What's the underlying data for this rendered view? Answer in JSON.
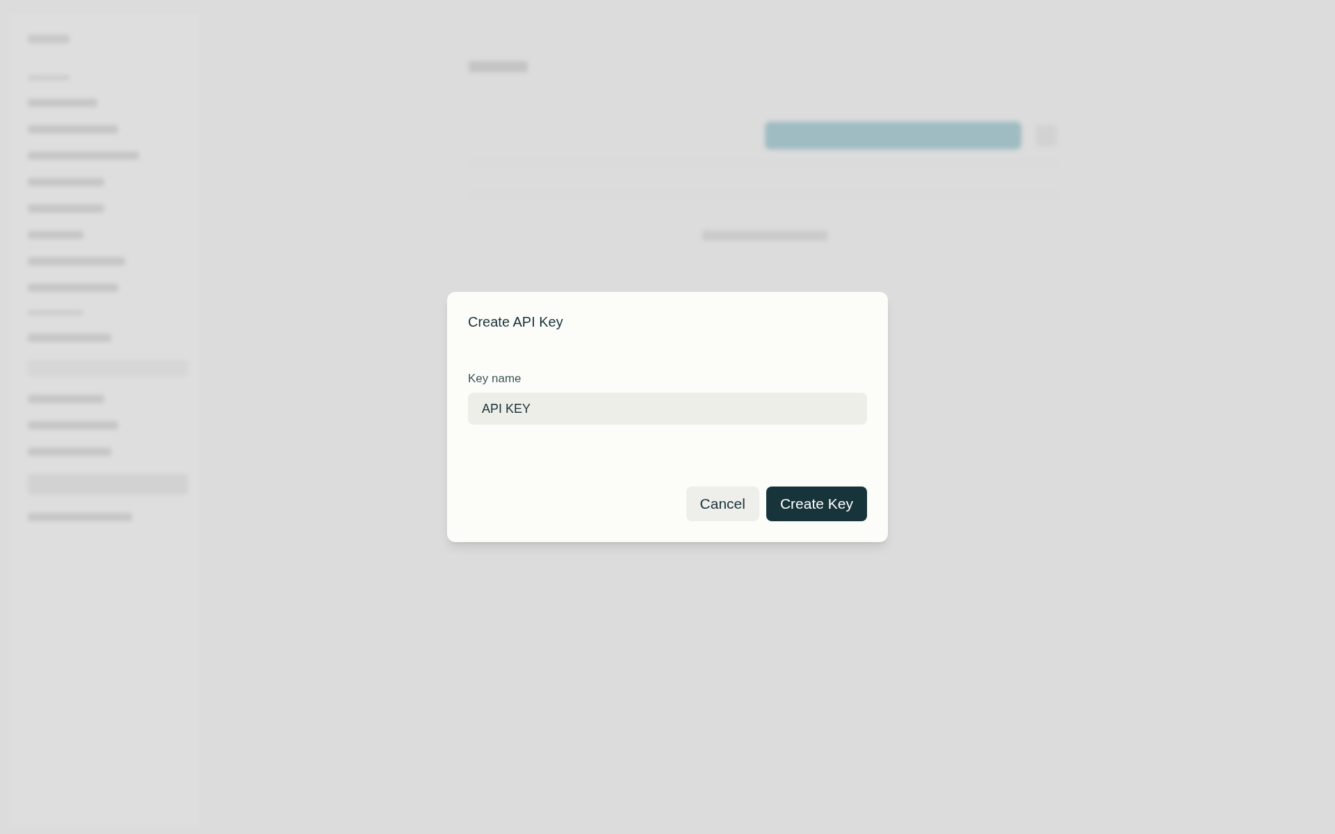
{
  "dialog": {
    "title": "Create API Key",
    "field": {
      "label": "Key name",
      "value": "API KEY"
    },
    "buttons": [
      {
        "kind": "secondary",
        "label": "Cancel"
      },
      {
        "kind": "primary",
        "label": "Create Key"
      }
    ]
  }
}
